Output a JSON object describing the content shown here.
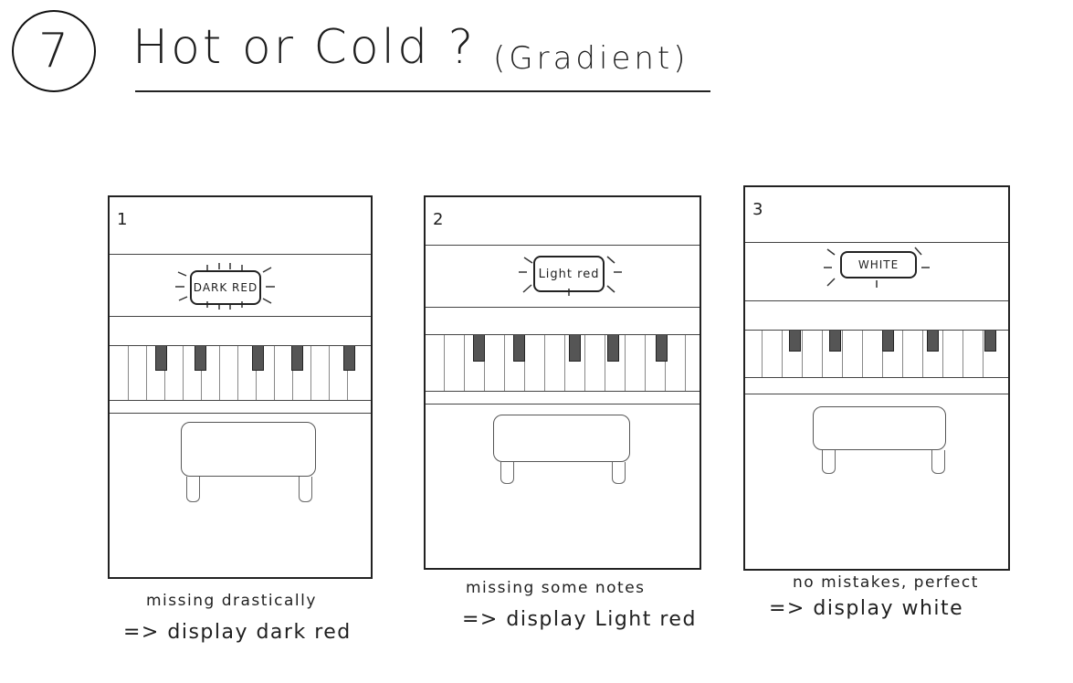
{
  "title": {
    "number": "7",
    "main": "Hot or Cold ?",
    "subtitle": "(Gradient)"
  },
  "panels": [
    {
      "number": "1",
      "badge": "DARK RED",
      "caption_top": "missing drastically",
      "caption_bottom": "=> display dark red"
    },
    {
      "number": "2",
      "badge": "Light red",
      "caption_top": "missing some notes",
      "caption_bottom": "=> display Light red"
    },
    {
      "number": "3",
      "badge": "WHITE",
      "caption_top": "no mistakes, perfect",
      "caption_bottom": "=> display white"
    }
  ]
}
